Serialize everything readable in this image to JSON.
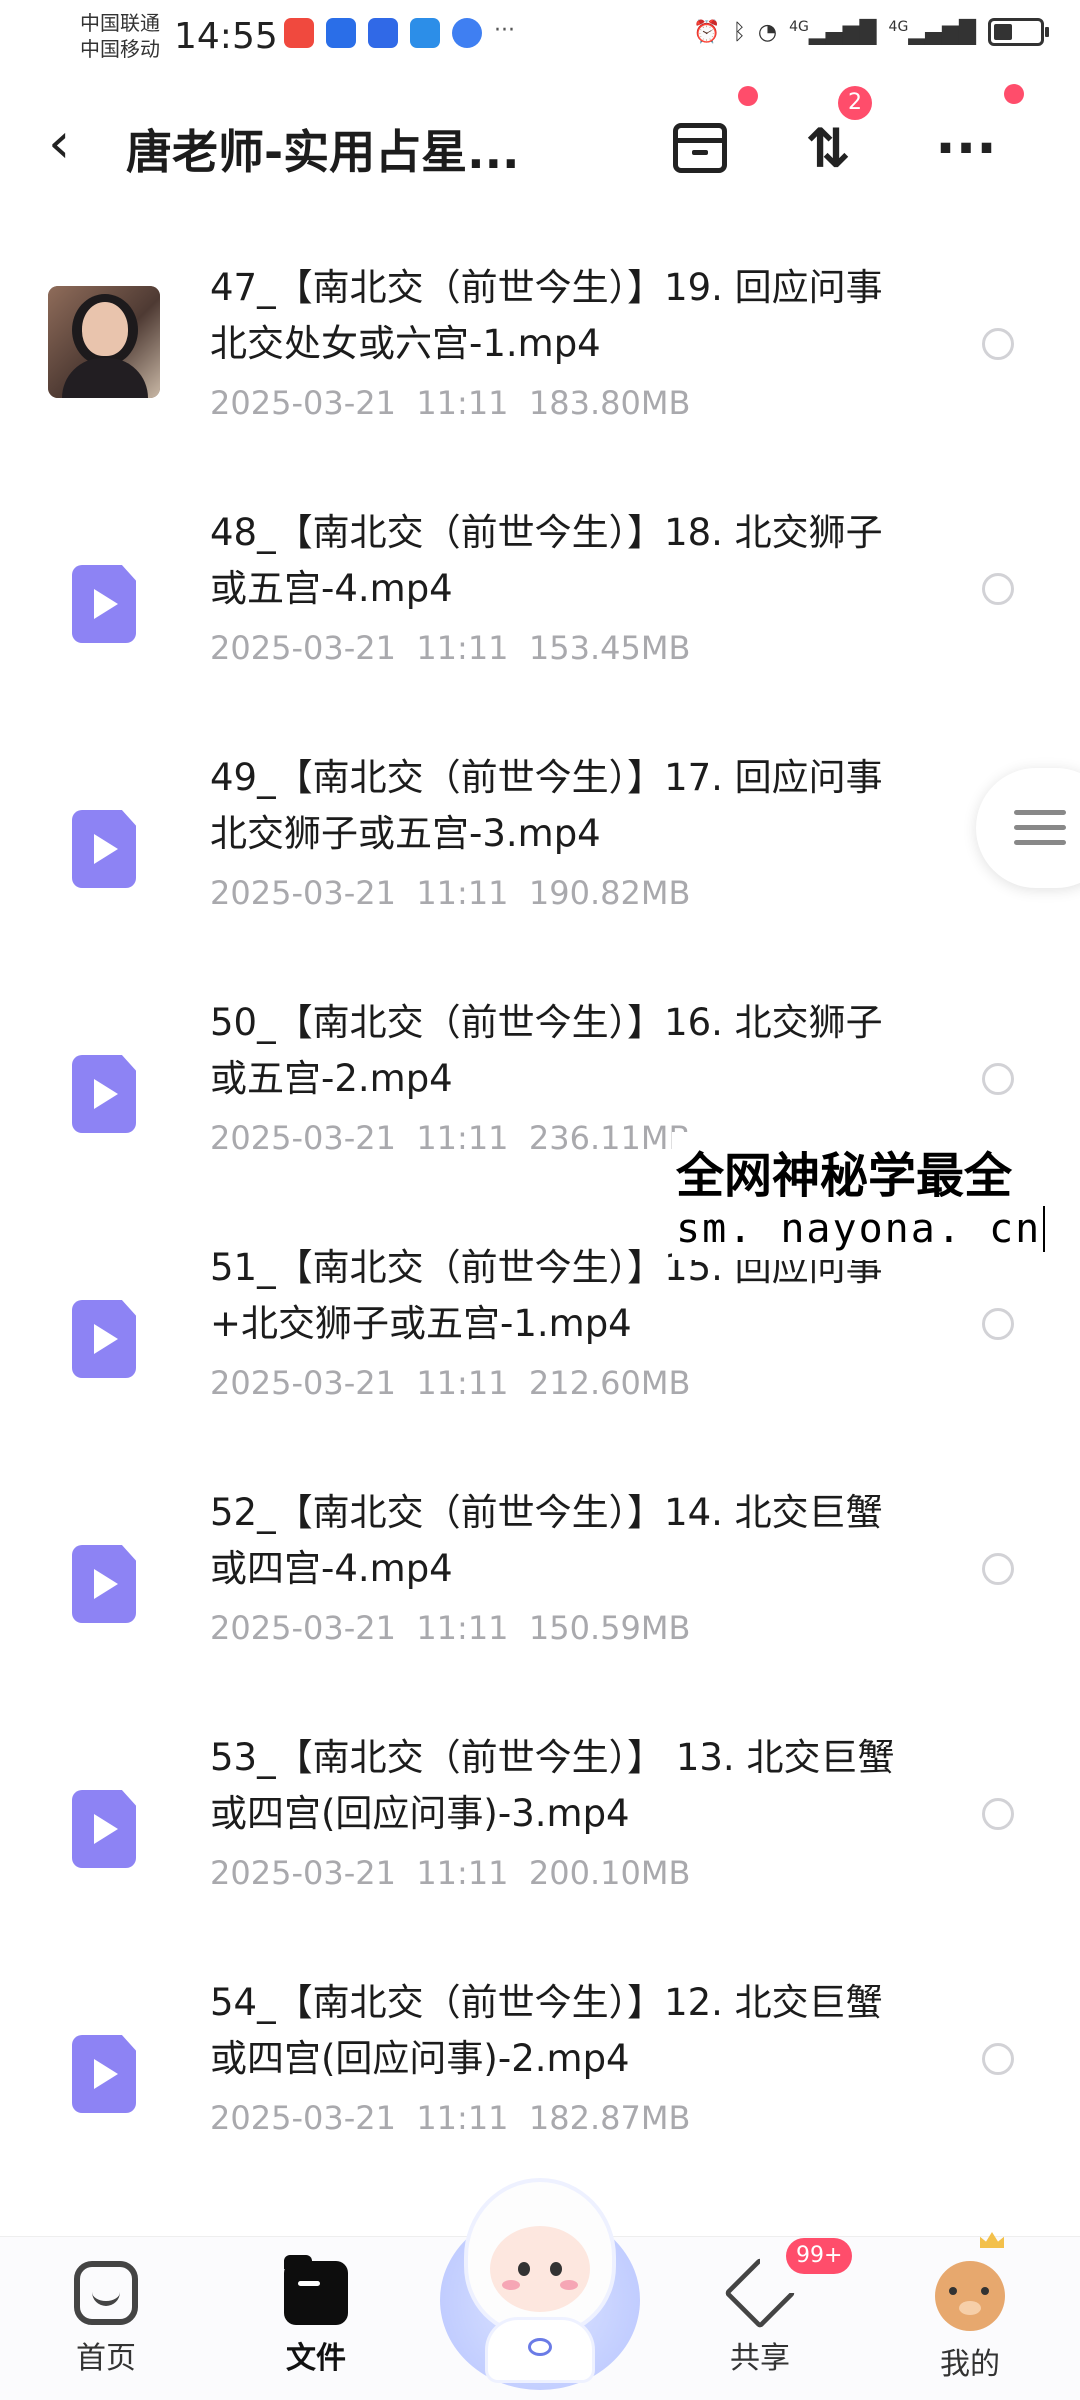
{
  "status_bar": {
    "carrier_1": "中国联通",
    "carrier_2": "中国移动",
    "time": "14:55",
    "app_icon_colors": [
      "#f0493e",
      "#2a6ee8",
      "#3069e7",
      "#2c8ee8",
      "#3f7ff2"
    ],
    "right_icons": [
      "alarm-icon",
      "bluetooth-icon",
      "wifi-icon",
      "signal-4g-icon",
      "signal-4g-icon",
      "battery-icon"
    ],
    "net_label_1": "4G",
    "net_label_2": "4G",
    "more_glyph": "···"
  },
  "header": {
    "back_glyph": "‹",
    "title": "唐老师-实用占星...",
    "transfer_badge": "2",
    "more_glyph": "···"
  },
  "files": [
    {
      "name": "47_【南北交（前世今生）】19. 回应问事 北交处女或六宫-1.mp4",
      "date": "2025-03-21",
      "time": "11:11",
      "size": "183.80MB",
      "thumb": "video-thumbnail"
    },
    {
      "name": "48_【南北交（前世今生）】18. 北交狮子或五宫-4.mp4",
      "date": "2025-03-21",
      "time": "11:11",
      "size": "153.45MB",
      "thumb": "video-file-icon"
    },
    {
      "name": "49_【南北交（前世今生）】17. 回应问事 北交狮子或五宫-3.mp4",
      "date": "2025-03-21",
      "time": "11:11",
      "size": "190.82MB",
      "thumb": "video-file-icon"
    },
    {
      "name": "50_【南北交（前世今生）】16. 北交狮子或五宫-2.mp4",
      "date": "2025-03-21",
      "time": "11:11",
      "size": "236.11MB",
      "thumb": "video-file-icon"
    },
    {
      "name": "51_【南北交（前世今生）】15. 回应问事+北交狮子或五宫-1.mp4",
      "date": "2025-03-21",
      "time": "11:11",
      "size": "212.60MB",
      "thumb": "video-file-icon"
    },
    {
      "name": "52_【南北交（前世今生）】14. 北交巨蟹或四宫-4.mp4",
      "date": "2025-03-21",
      "time": "11:11",
      "size": "150.59MB",
      "thumb": "video-file-icon"
    },
    {
      "name": "53_【南北交（前世今生）】 13. 北交巨蟹或四宫(回应问事)-3.mp4",
      "date": "2025-03-21",
      "time": "11:11",
      "size": "200.10MB",
      "thumb": "video-file-icon"
    },
    {
      "name": "54_【南北交（前世今生）】12. 北交巨蟹或四宫(回应问事)-2.mp4",
      "date": "2025-03-21",
      "time": "11:11",
      "size": "182.87MB",
      "thumb": "video-file-icon"
    }
  ],
  "watermark": {
    "line1": "全网神秘学最全",
    "line2": "sm. nayona. cn"
  },
  "bottom_nav": {
    "items": [
      {
        "label": "首页",
        "icon": "home-icon",
        "active": false
      },
      {
        "label": "文件",
        "icon": "folder-icon",
        "active": true
      },
      {
        "label": "共享",
        "icon": "share-icon",
        "active": false
      },
      {
        "label": "我的",
        "icon": "profile-avatar-icon",
        "active": false
      }
    ],
    "share_badge": "99+"
  },
  "colors": {
    "accent": "#8d83f4",
    "badge": "#ff4d6b",
    "meta_text": "#a9a9ad"
  }
}
